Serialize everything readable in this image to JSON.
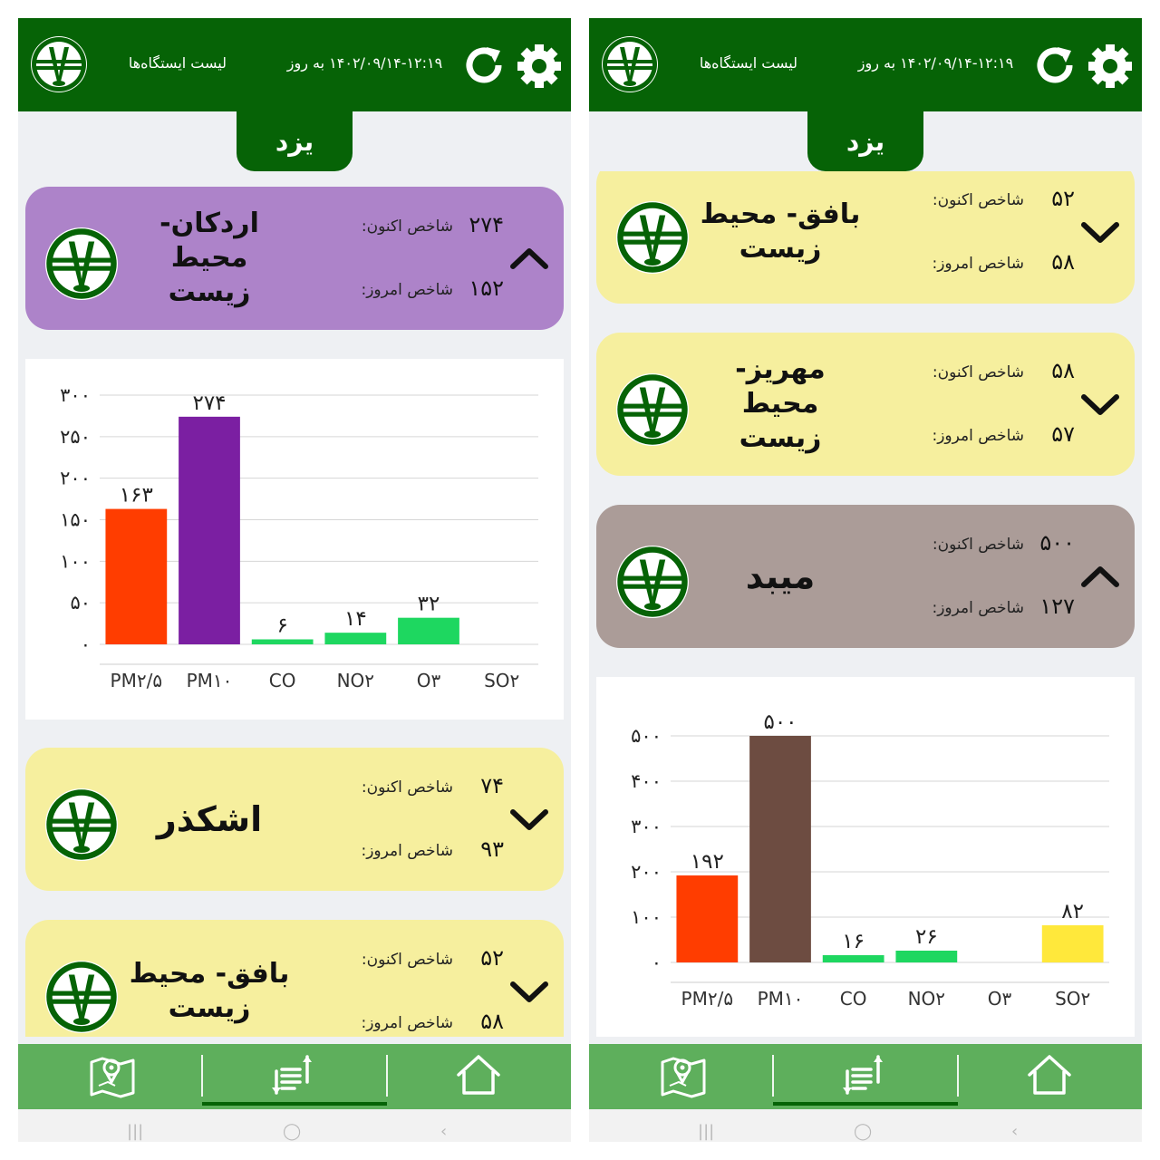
{
  "colors": {
    "header_green": "#066306",
    "nav_green": "#5eaf5c",
    "purple_card": "#ad83c9",
    "yellow_card": "#f6ef9e",
    "brown_card": "#ab9c98",
    "pm25_bar": "#ff3d00",
    "pm10_left_bar": "#7b1fa2",
    "pm10_right_bar": "#6d4c41",
    "good_bar": "#1ed760",
    "so2_bar": "#ffe83b"
  },
  "icons": {
    "logo": "doe-logo-icon",
    "refresh": "refresh-icon",
    "settings": "gear-icon",
    "expand": "chevron-down-icon",
    "collapse": "chevron-up-icon",
    "nav_map": "map-pin-icon",
    "nav_list": "sort-list-icon",
    "nav_home": "home-icon"
  },
  "header": {
    "title": "لیست ایستگاه‌ها",
    "updated": "۱۴۰۲/۰۹/۱۴-۱۲:۱۹   به روز"
  },
  "city": "یزد",
  "labels": {
    "now": "شاخص اکنون:",
    "today": "شاخص امروز:"
  },
  "left": {
    "ardakan": {
      "name": "اردکان- محیط زیست",
      "now": "۲۷۴",
      "today": "۱۵۲"
    },
    "ashkezar": {
      "name": "اشکذر",
      "now": "۷۴",
      "today": "۹۳"
    },
    "bafgh": {
      "name": "بافق- محیط زیست",
      "now": "۵۲",
      "today": "۵۸"
    }
  },
  "right": {
    "bafgh": {
      "name": "بافق- محیط زیست",
      "now": "۵۲",
      "today": "۵۸"
    },
    "mehriz": {
      "name": "مهریز- محیط زیست",
      "now": "۵۸",
      "today": "۵۷"
    },
    "meybod": {
      "name": "میبد",
      "now": "۵۰۰",
      "today": "۱۲۷"
    }
  },
  "chart_data": [
    {
      "type": "bar",
      "categories": [
        "PM۲/۵",
        "PM۱۰",
        "CO",
        "NO۲",
        "O۳",
        "SO۲"
      ],
      "values": [
        163,
        274,
        6,
        14,
        32,
        null
      ],
      "value_labels": [
        "۱۶۳",
        "۲۷۴",
        "۶",
        "۱۴",
        "۳۲",
        ""
      ],
      "colors": [
        "#ff3d00",
        "#7b1fa2",
        "#1ed760",
        "#1ed760",
        "#1ed760",
        "#1ed760"
      ],
      "ylim": [
        0,
        300
      ],
      "yticks": [
        0,
        50,
        100,
        150,
        200,
        250,
        300
      ],
      "ytick_labels": [
        "۰",
        "۵۰",
        "۱۰۰",
        "۱۵۰",
        "۲۰۰",
        "۲۵۰",
        "۳۰۰"
      ],
      "grid": true,
      "xlabel": "",
      "ylabel": "",
      "title": ""
    },
    {
      "type": "bar",
      "categories": [
        "PM۲/۵",
        "PM۱۰",
        "CO",
        "NO۲",
        "O۳",
        "SO۲"
      ],
      "values": [
        192,
        500,
        16,
        26,
        null,
        82
      ],
      "value_labels": [
        "۱۹۲",
        "۵۰۰",
        "۱۶",
        "۲۶",
        "",
        "۸۲"
      ],
      "colors": [
        "#ff3d00",
        "#6d4c41",
        "#1ed760",
        "#1ed760",
        "#1ed760",
        "#ffe83b"
      ],
      "ylim": [
        0,
        500
      ],
      "yticks": [
        0,
        100,
        200,
        300,
        400,
        500
      ],
      "ytick_labels": [
        "۰",
        "۱۰۰",
        "۲۰۰",
        "۳۰۰",
        "۴۰۰",
        "۵۰۰"
      ],
      "grid": true,
      "xlabel": "",
      "ylabel": "",
      "title": ""
    }
  ],
  "system_nav": {
    "recents": "|||",
    "home": "◯",
    "back": "‹"
  }
}
